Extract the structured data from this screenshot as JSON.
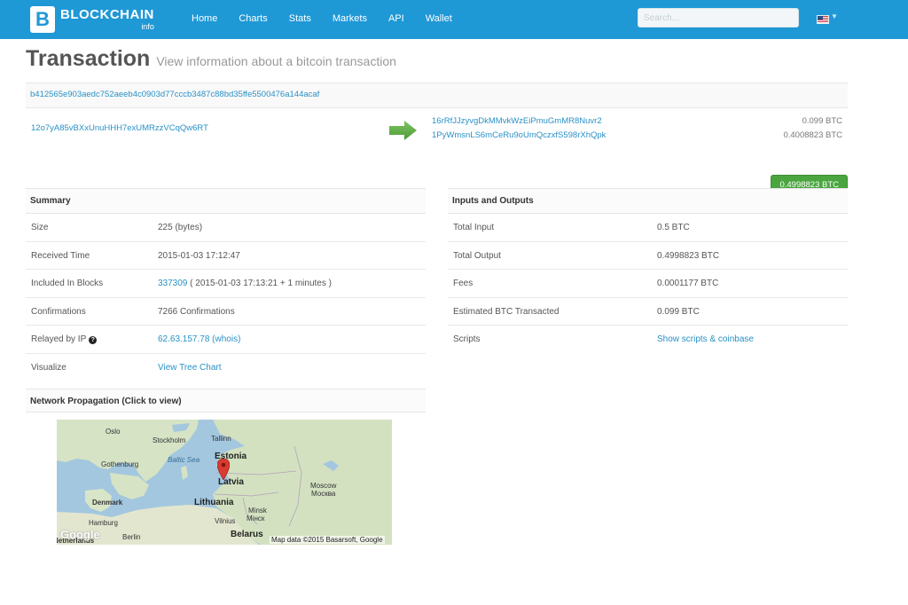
{
  "header": {
    "logo_text": "BLOCKCHAIN",
    "logo_sub": "info",
    "logo_mark": "B",
    "nav": [
      "Home",
      "Charts",
      "Stats",
      "Markets",
      "API",
      "Wallet"
    ],
    "search_placeholder": "Search..."
  },
  "title": {
    "main": "Transaction",
    "sub": "View information about a bitcoin transaction"
  },
  "transaction": {
    "hash": "b412565e903aedc752aeeb4c0903d77cccb3487c88bd35ffe5500476a144acaf",
    "input_address": "12o7yA85vBXxUnuHHH7exUMRzzVCqQw6RT",
    "outputs": [
      {
        "address": "16rRfJJzyvgDkMMvkWzEiPmuGmMR8Nuvr2",
        "amount": "0.099 BTC"
      },
      {
        "address": "1PyWmsnLS6mCeRu9oUmQczxfS598rXhQpk",
        "amount": "0.4008823 BTC"
      }
    ],
    "total": "0.4998823 BTC"
  },
  "summary": {
    "header": "Summary",
    "rows": [
      {
        "key": "Size",
        "value": "225 (bytes)"
      },
      {
        "key": "Received Time",
        "value": "2015-01-03 17:12:47"
      },
      {
        "key": "Included In Blocks",
        "block": "337309",
        "value_suffix": " ( 2015-01-03 17:13:21 + 1 minutes )"
      },
      {
        "key": "Confirmations",
        "value": "7266 Confirmations"
      },
      {
        "key": "Relayed by IP",
        "ip": "62.63.157.78",
        "whois": " (whois)"
      },
      {
        "key": "Visualize",
        "value": "View Tree Chart"
      }
    ]
  },
  "inputs_outputs": {
    "header": "Inputs and Outputs",
    "rows": [
      {
        "key": "Total Input",
        "value": "0.5 BTC"
      },
      {
        "key": "Total Output",
        "value": "0.4998823 BTC"
      },
      {
        "key": "Fees",
        "value": "0.0001177 BTC"
      },
      {
        "key": "Estimated BTC Transacted",
        "value": "0.099 BTC"
      },
      {
        "key": "Scripts",
        "value": "Show scripts & coinbase"
      }
    ]
  },
  "network": {
    "header": "Network Propagation (Click to view)",
    "map_labels": {
      "oslo": "Oslo",
      "stockholm": "Stockholm",
      "tallinn": "Tallinn",
      "estonia": "Estonia",
      "baltic_sea": "Baltic Sea",
      "gothenburg": "Gothenburg",
      "latvia": "Latvia",
      "moscow": "Moscow",
      "moscow_ru": "Москва",
      "denmark": "Denmark",
      "lithuania": "Lithuania",
      "minsk": "Minsk",
      "minsk_ru": "Мінск",
      "vilnius": "Vilnius",
      "hamburg": "Hamburg",
      "berlin": "Berlin",
      "belarus": "Belarus",
      "netherlands": "Netherlands",
      "google": "Google",
      "attribution": "Map data ©2015 Basarsoft, Google"
    }
  }
}
